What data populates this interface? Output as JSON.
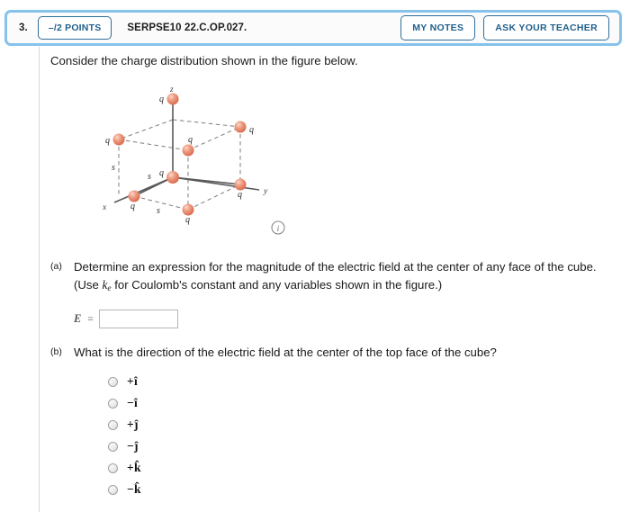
{
  "header": {
    "question_number": "3.",
    "points_badge": "–/2 POINTS",
    "question_code": "SERPSE10 22.C.OP.027.",
    "my_notes_label": "MY NOTES",
    "ask_teacher_label": "ASK YOUR TEACHER",
    "border_color": "#86c2ea",
    "button_color": "#2e6f9b"
  },
  "intro": "Consider the charge distribution shown in the figure below.",
  "figure": {
    "info_icon": "info-icon",
    "axis_labels": {
      "x": "x",
      "y": "y",
      "z": "z"
    },
    "charge_label": "q",
    "side_label": "s",
    "charge_labels": [
      "q",
      "q",
      "q",
      "q",
      "q",
      "q",
      "q",
      "q"
    ],
    "side_labels": [
      "s",
      "s",
      "s"
    ],
    "sphere_color": "#e4826a",
    "sphere_highlight": "#f6c3b2",
    "line_color": "#555555"
  },
  "parts": [
    {
      "label": "(a)",
      "text_before": "Determine an expression for the magnitude of the electric field at the center of any face of the cube. (Use ",
      "symbol": "k",
      "symbol_sub": "e",
      "text_after": " for Coulomb's constant and any variables shown in the figure.)",
      "answer": {
        "var_label": "E",
        "equals": "=",
        "value": "",
        "placeholder": ""
      }
    },
    {
      "label": "(b)",
      "text": "What is the direction of the electric field at the center of the top face of the cube?",
      "options": [
        {
          "label": "+î",
          "selected": false
        },
        {
          "label": "−î",
          "selected": false
        },
        {
          "label": "+ĵ",
          "selected": false
        },
        {
          "label": "−ĵ",
          "selected": false
        },
        {
          "label": "+k̂",
          "selected": false
        },
        {
          "label": "−k̂",
          "selected": false
        }
      ]
    }
  ]
}
